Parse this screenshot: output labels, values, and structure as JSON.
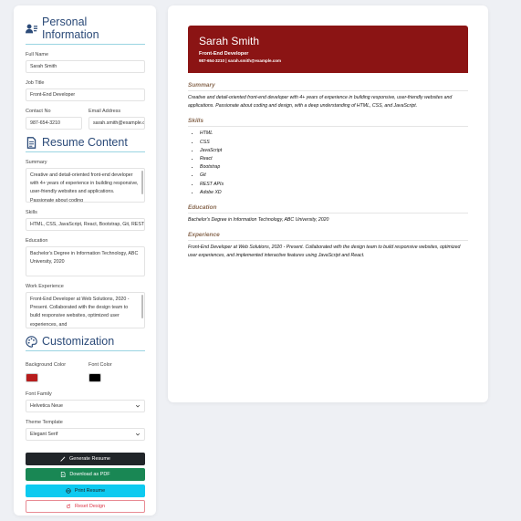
{
  "colors": {
    "background": "#b71c1c",
    "font": "#000000",
    "header_bg": "#8b1414",
    "accent_line": "#9ad4e2",
    "heading_blue": "#2b4a78"
  },
  "personal": {
    "heading": "Personal Information",
    "icon": "user-card-icon",
    "full_name_label": "Full Name",
    "full_name": "Sarah Smith",
    "job_title_label": "Job Title",
    "job_title": "Front-End Developer",
    "contact_label": "Contact No",
    "contact": "987-654-3210",
    "email_label": "Email Address",
    "email": "sarah.smith@example.com"
  },
  "content": {
    "heading": "Resume Content",
    "icon": "document-icon",
    "summary_label": "Summary",
    "summary": "Creative and detail-oriented front-end developer with 4+ years of experience in building responsive, user-friendly websites and applications. Passionate about coding",
    "skills_label": "Skills",
    "skills": "HTML, CSS, JavaScript, React, Bootstrap, Git, REST APIs, Adobe XD",
    "education_label": "Education",
    "education": "Bachelor's Degree in Information Technology, ABC University, 2020",
    "experience_label": "Work Experience",
    "experience": "Front-End Developer at Web Solutions, 2020 - Present. Collaborated with the design team to build responsive websites, optimized user experiences, and"
  },
  "custom": {
    "heading": "Customization",
    "icon": "palette-icon",
    "bg_color_label": "Background Color",
    "font_color_label": "Font Color",
    "font_family_label": "Font Family",
    "font_family": "Helvetica Neue",
    "template_label": "Theme Template",
    "template": "Elegant Serif"
  },
  "buttons": {
    "generate": "Generate Resume",
    "download": "Download as PDF",
    "print": "Print Resume",
    "reset": "Reset Design"
  },
  "resume": {
    "name": "Sarah Smith",
    "title": "Front-End Developer",
    "contact_line": "987-654-3210 | sarah.smith@example.com",
    "summary_h": "Summary",
    "summary": "Creative and detail-oriented front-end developer with 4+ years of experience in building responsive, user-friendly websites and applications. Passionate about coding and design, with a deep understanding of HTML, CSS, and JavaScript.",
    "skills_h": "Skills",
    "skills": [
      "HTML",
      "CSS",
      "JavaScript",
      "React",
      "Bootstrap",
      "Git",
      "REST APIs",
      "Adobe XD"
    ],
    "education_h": "Education",
    "education": "Bachelor's Degree in Information Technology, ABC University, 2020",
    "experience_h": "Experience",
    "experience": "Front-End Developer at Web Solutions, 2020 - Present. Collaborated with the design team to build responsive websites, optimized user experiences, and implemented interactive features using JavaScript and React."
  }
}
